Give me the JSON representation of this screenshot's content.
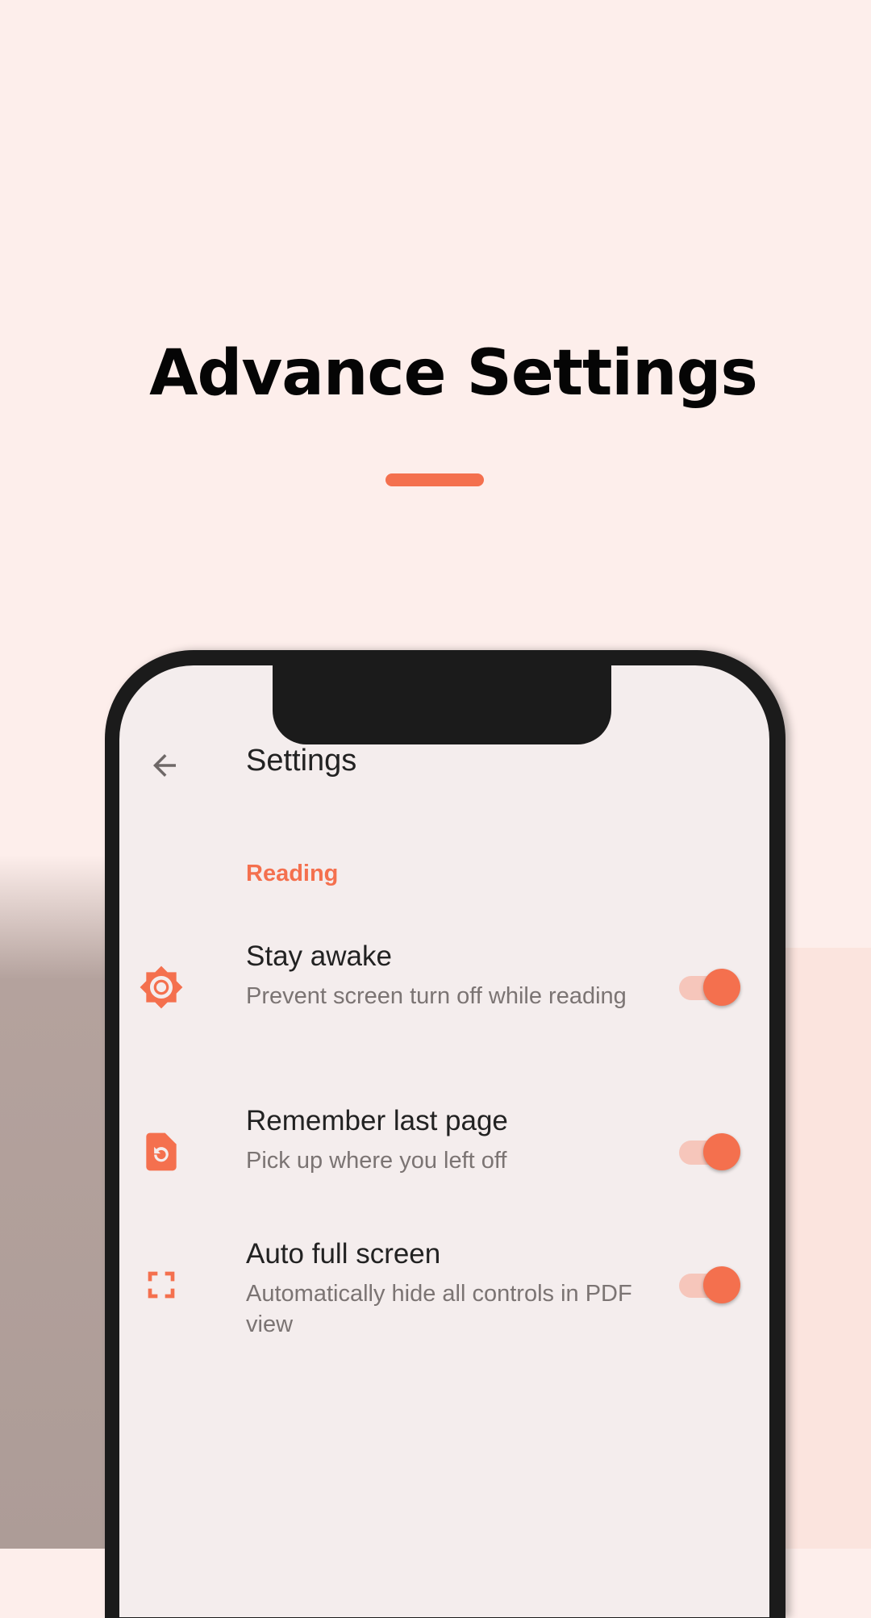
{
  "colors": {
    "accent": "#f4704e",
    "background": "#fdeeeb",
    "screen": "#f4eded"
  },
  "hero": {
    "title": "Advance Settings"
  },
  "app": {
    "title": "Settings",
    "back_icon": "arrow-back-icon",
    "section": "Reading",
    "settings": [
      {
        "title": "Stay awake",
        "subtitle": "Prevent screen turn off while reading",
        "icon": "brightness-icon",
        "enabled": true
      },
      {
        "title": "Remember last page",
        "subtitle": "Pick up where you left off",
        "icon": "restore-page-icon",
        "enabled": true
      },
      {
        "title": "Auto full screen",
        "subtitle": "Automatically hide all controls in PDF view",
        "icon": "fullscreen-icon",
        "enabled": true
      }
    ]
  }
}
